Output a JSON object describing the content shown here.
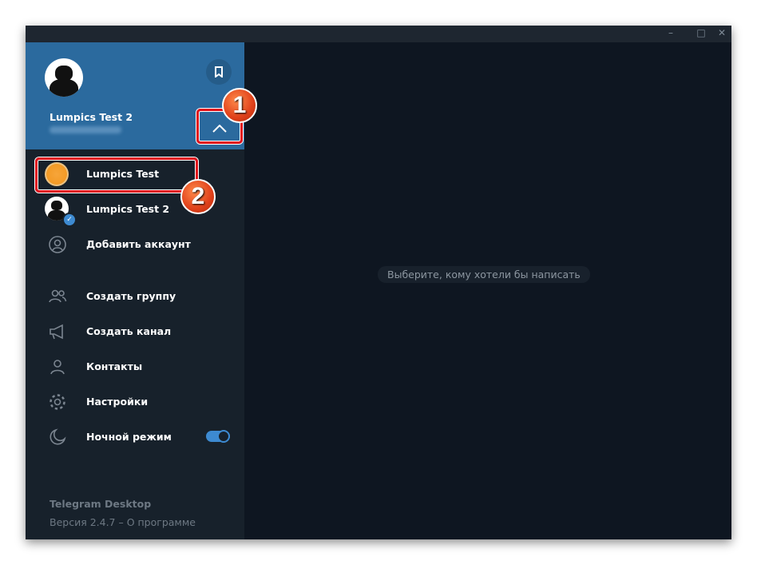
{
  "window": {
    "controls": [
      "minimize",
      "maximize",
      "close"
    ]
  },
  "profile": {
    "name": "Lumpics Test 2"
  },
  "accounts": [
    {
      "name": "Lumpics Test"
    },
    {
      "name": "Lumpics Test 2"
    }
  ],
  "add_account": "Добавить аккаунт",
  "menu": [
    {
      "label": "Создать группу",
      "icon": "group-icon"
    },
    {
      "label": "Создать канал",
      "icon": "megaphone-icon"
    },
    {
      "label": "Контакты",
      "icon": "contact-icon"
    },
    {
      "label": "Настройки",
      "icon": "gear-icon"
    },
    {
      "label": "Ночной режим",
      "icon": "moon-icon"
    }
  ],
  "night_mode": true,
  "footer": {
    "app": "Telegram Desktop",
    "version": "Версия 2.4.7 – О программе"
  },
  "main": {
    "placeholder": "Выберите, кому хотели бы написать"
  },
  "annotations": [
    "1",
    "2"
  ]
}
